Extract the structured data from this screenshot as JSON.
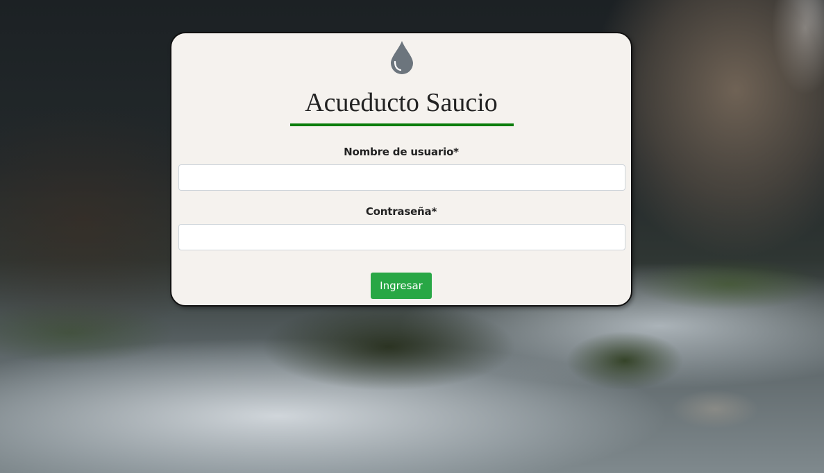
{
  "colors": {
    "card_background": "#f5f2ee",
    "underline": "#0a7d0a",
    "button": "#28a745",
    "icon": "#6c757d"
  },
  "brand": {
    "icon": "water-drop-icon",
    "title": "Acueducto Saucio"
  },
  "form": {
    "username_label": "Nombre de usuario*",
    "username_value": "",
    "password_label": "Contraseña*",
    "password_value": "",
    "submit_label": "Ingresar"
  }
}
